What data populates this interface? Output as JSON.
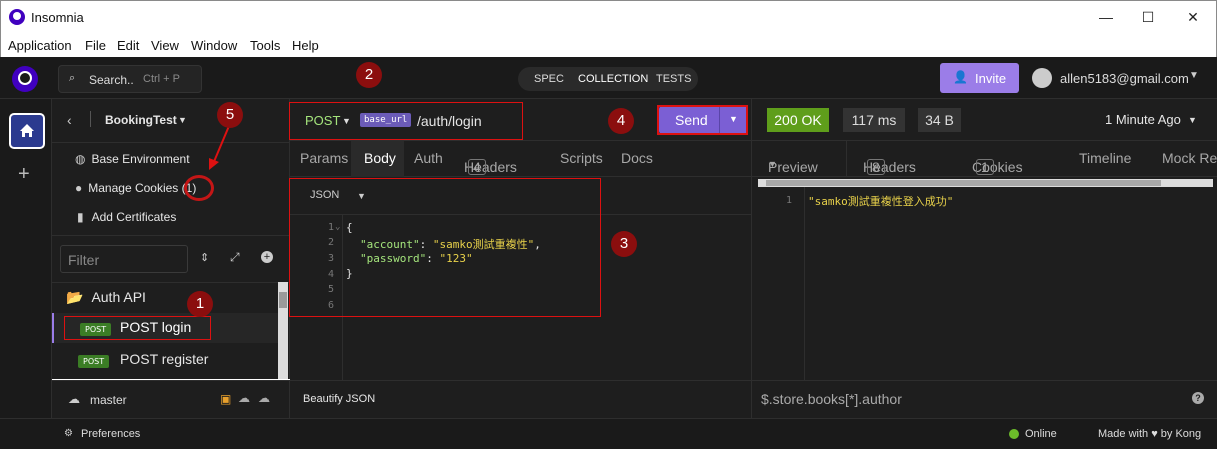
{
  "window": {
    "title": "Insomnia",
    "controls": {
      "minimize": "—",
      "maximize": "☐",
      "close": "✕"
    }
  },
  "menu": [
    "Application",
    "File",
    "Edit",
    "View",
    "Window",
    "Tools",
    "Help"
  ],
  "header": {
    "search_label": "Search..",
    "search_shortcut": "Ctrl + P",
    "modes": [
      "SPEC",
      "COLLECTION",
      "TESTS"
    ],
    "active_mode": "COLLECTION",
    "invite_label": "Invite",
    "user_email": "allen5183@gmail.com"
  },
  "sidebar": {
    "project_name": "BookingTest",
    "links": [
      {
        "label": "Base Environment",
        "icon": "globe-icon"
      },
      {
        "label": "Manage Cookies",
        "count": "(1)",
        "icon": "cookie-icon"
      },
      {
        "label": "Add Certificates",
        "icon": "certificate-icon"
      }
    ],
    "filter_placeholder": "Filter",
    "folder": "Auth API",
    "requests": [
      {
        "method": "POST",
        "name": "POST login"
      },
      {
        "method": "POST",
        "name": "POST register"
      }
    ],
    "branch": "master"
  },
  "request": {
    "method": "POST",
    "url_tag": "base_url",
    "url_path": "/auth/login",
    "send_label": "Send",
    "tabs": [
      "Params",
      "Body",
      "Auth",
      "Headers",
      "Scripts",
      "Docs"
    ],
    "headers_count": "4",
    "active_tab": "Body",
    "body_type": "JSON",
    "line_numbers": [
      "1",
      "2",
      "3",
      "4",
      "5",
      "6"
    ],
    "code": {
      "open": "{",
      "key1": "\"account\"",
      "val1": "\"samko測試重複性\"",
      "key2": "\"password\"",
      "val2": "\"123\"",
      "close": "}"
    },
    "footer_label": "Beautify JSON"
  },
  "response": {
    "status": "200 OK",
    "time": "117 ms",
    "size": "34 B",
    "age": "1 Minute Ago",
    "tabs": [
      "Preview",
      "Headers",
      "Cookies",
      "Timeline",
      "Mock Res"
    ],
    "headers_count": "8",
    "cookies_count": "1",
    "line_number": "1",
    "body": "\"samko測試重複性登入成功\"",
    "filter_placeholder": "$.store.books[*].author"
  },
  "statusbar": {
    "preferences": "Preferences",
    "online": "Online",
    "made_with": "Made with ♥ by Kong"
  },
  "annotations": [
    "1",
    "2",
    "3",
    "4",
    "5"
  ],
  "colors": {
    "accent": "#9b7de8",
    "status_ok": "#5f9e1b",
    "post_method": "#a4e47c",
    "annotation": "#8b0e0e"
  }
}
